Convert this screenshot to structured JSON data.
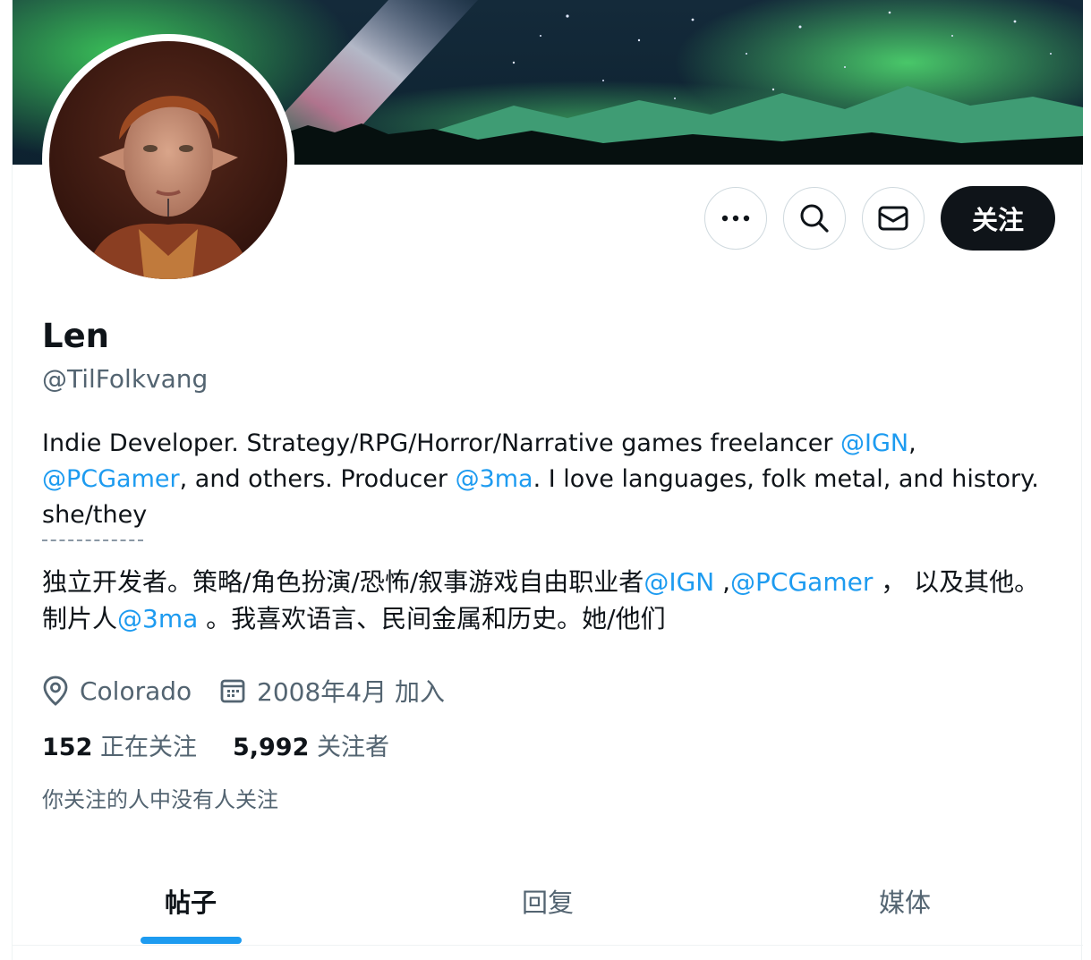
{
  "profile": {
    "name": "Len",
    "handle": "@TilFolkvang",
    "bio_en": {
      "p1": "Indie Developer. Strategy/RPG/Horror/Narrative games freelancer ",
      "m1": "@IGN",
      "p2": ",",
      "m2": "@PCGamer",
      "p3": ", and others. Producer ",
      "m3": "@3ma",
      "p4": ". I love languages, folk metal, and history. she/they"
    },
    "bio_zh": {
      "p1": "独立开发者。策略/角色扮演/恐怖/叙事游戏自由职业者",
      "m1": "@IGN",
      "p2": " ,",
      "m2": "@PCGamer",
      "p3": " ， 以及其他。制片人",
      "m3": "@3ma",
      "p4": " 。我喜欢语言、民间金属和历史。她/他们"
    },
    "separator": "------------",
    "location": "Colorado",
    "joined": "2008年4月 加入",
    "following_count": "152",
    "following_label": "正在关注",
    "followers_count": "5,992",
    "followers_label": "关注者",
    "mutual_note": "你关注的人中没有人关注"
  },
  "actions": {
    "more_icon": "more-icon",
    "search_icon": "search-icon",
    "message_icon": "mail-icon",
    "follow_label": "关注"
  },
  "tabs": [
    {
      "label": "帖子",
      "active": true
    },
    {
      "label": "回复",
      "active": false
    },
    {
      "label": "媒体",
      "active": false
    }
  ],
  "colors": {
    "accent": "#1d9bf0",
    "text": "#0f1419",
    "secondary": "#536471",
    "follow_bg": "#0f1419"
  }
}
